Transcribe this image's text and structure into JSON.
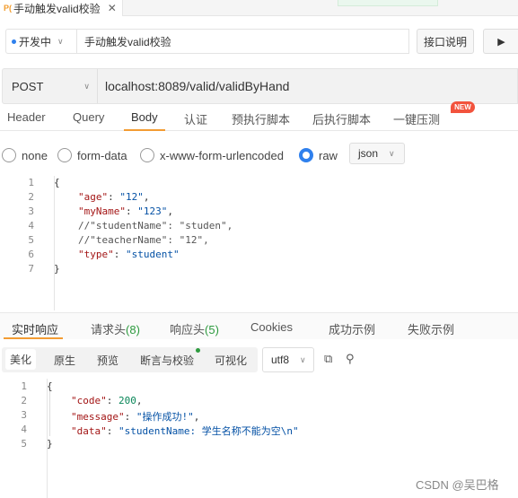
{
  "doc_tab": {
    "badge": "P(",
    "title": "手动触发valid校验",
    "close": "✕"
  },
  "name_row": {
    "status": "开发中",
    "name": "手动触发valid校验",
    "doc_button": "接口说明",
    "run_icon": "play-icon"
  },
  "url_row": {
    "method": "POST",
    "url": "localhost:8089/valid/validByHand"
  },
  "request_tabs": [
    "Header",
    "Query",
    "Body",
    "认证",
    "预执行脚本",
    "后执行脚本",
    "一键压测"
  ],
  "new_badge": "NEW",
  "body_types": [
    "none",
    "form-data",
    "x-www-form-urlencoded",
    "raw"
  ],
  "body_format": "json",
  "request_body": {
    "line_numbers": [
      "1",
      "2",
      "3",
      "4",
      "5",
      "6",
      "7"
    ],
    "l1": "{",
    "l2_key": "\"age\"",
    "l2_val": "\"12\"",
    "l3_key": "\"myName\"",
    "l3_val": "\"123\"",
    "l4": "//\"studentName\": \"studen\",",
    "l5": "//\"teacherName\": \"12\",",
    "l6_key": "\"type\"",
    "l6_val": "\"student\"",
    "l7": "}"
  },
  "response_tabs": {
    "realtime": "实时响应",
    "req_headers": "请求头",
    "req_headers_count": "(8)",
    "resp_headers": "响应头",
    "resp_headers_count": "(5)",
    "cookies": "Cookies",
    "success_example": "成功示例",
    "fail_example": "失败示例"
  },
  "view_modes": [
    "美化",
    "原生",
    "预览",
    "断言与校验",
    "可视化"
  ],
  "encoding": "utf8",
  "response_body": {
    "line_numbers": [
      "1",
      "2",
      "3",
      "4",
      "5"
    ],
    "l1": "{",
    "l2_key": "\"code\"",
    "l2_val": "200",
    "l3_key": "\"message\"",
    "l3_val": "\"操作成功!\"",
    "l4_key": "\"data\"",
    "l4_val": "\"studentName: 学生名称不能为空\\n\"",
    "l5": "}"
  },
  "watermark": "CSDN @吴巴格",
  "colors": {
    "accent": "#f39c33",
    "primary": "#2f80ed",
    "success": "#2e9b3f",
    "badge": "#f2533d"
  }
}
